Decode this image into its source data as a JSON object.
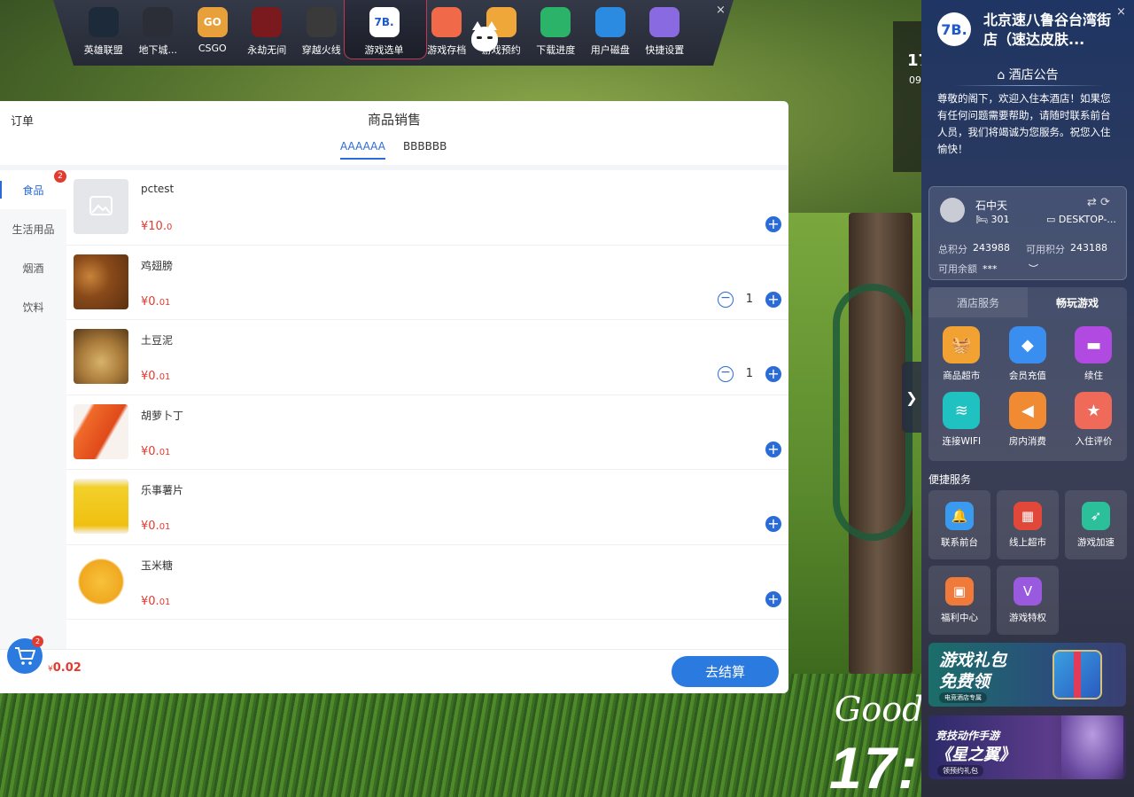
{
  "topbar": {
    "items": [
      {
        "label": "英雄联盟",
        "icon": "lol-icon",
        "color": "#1d2a3a"
      },
      {
        "label": "地下城...",
        "icon": "dnf-icon",
        "color": "#2b2e36"
      },
      {
        "label": "CSGO",
        "icon": "csgo-icon",
        "color": "#e8a13a",
        "text": "GO"
      },
      {
        "label": "永劫无间",
        "icon": "naraka-icon",
        "color": "#7a1a1e"
      },
      {
        "label": "穿越火线",
        "icon": "cf-icon",
        "color": "#3a3a3a"
      },
      {
        "label": "游戏选单",
        "icon": "menu-logo-icon",
        "color": "#ffffff",
        "text": "7B."
      },
      {
        "label": "游戏存档",
        "icon": "save-icon",
        "color": "#f06a4a"
      },
      {
        "label": "游戏预约",
        "icon": "reserve-icon",
        "color": "#f0a73a"
      },
      {
        "label": "下载进度",
        "icon": "download-icon",
        "color": "#2bb36a"
      },
      {
        "label": "用户磁盘",
        "icon": "disk-icon",
        "color": "#2b8be0"
      },
      {
        "label": "快捷设置",
        "icon": "settings-icon",
        "color": "#8a6ae0"
      }
    ],
    "close": "×"
  },
  "panel": {
    "order_label": "订单",
    "title": "商品销售",
    "tabs": [
      "AAAAAA",
      "BBBBBB"
    ],
    "active_tab": 0,
    "categories": [
      "食品",
      "生活用品",
      "烟酒",
      "饮料"
    ],
    "category_badge": "2",
    "products": [
      {
        "name": "pctest",
        "price_main": "¥10.",
        "price_dec": "0",
        "qty": null,
        "thumb": "placeholder-image-icon"
      },
      {
        "name": "鸡翅膀",
        "price_main": "¥0.",
        "price_dec": "01",
        "qty": "1",
        "thumb": "chicken-wings-image"
      },
      {
        "name": "土豆泥",
        "price_main": "¥0.",
        "price_dec": "01",
        "qty": "1",
        "thumb": "mashed-potato-image"
      },
      {
        "name": "胡萝卜丁",
        "price_main": "¥0.",
        "price_dec": "01",
        "qty": null,
        "thumb": "carrot-image"
      },
      {
        "name": "乐事薯片",
        "price_main": "¥0.",
        "price_dec": "01",
        "qty": null,
        "thumb": "chips-image"
      },
      {
        "name": "玉米糖",
        "price_main": "¥0.",
        "price_dec": "01",
        "qty": null,
        "thumb": "corn-candy-image"
      }
    ],
    "cart_badge": "2",
    "total_prefix": "¥",
    "total": "0.02",
    "checkout_label": "去结算",
    "accent": "#2b7ae0",
    "price_color": "#e23b30"
  },
  "hotel": {
    "logo_text": "7B.",
    "name": "北京速八鲁谷台湾街店（速达皮肤...",
    "close": "×",
    "notice_title": "酒店公告",
    "notice_text": "尊敬的阁下，欢迎入住本酒店！如果您有任何问题需要帮助，请随时联系前台人员，我们将竭诚为您服务。祝您入住愉快！",
    "user": {
      "name": "石中天",
      "room": "301",
      "pc": "DESKTOP-...",
      "total_points_label": "总积分",
      "total_points": "243988",
      "avail_points_label": "可用积分",
      "avail_points": "243188",
      "balance_label": "可用余额",
      "balance": "***"
    },
    "service_tabs": [
      "酒店服务",
      "畅玩游戏"
    ],
    "active_service_tab": 1,
    "services": [
      {
        "label": "商品超市",
        "icon": "basket-icon",
        "color": "#f2a233"
      },
      {
        "label": "会员充值",
        "icon": "diamond-icon",
        "color": "#3a8ef0"
      },
      {
        "label": "续住",
        "icon": "bed-icon",
        "color": "#b04ae0"
      },
      {
        "label": "连接WIFI",
        "icon": "wifi-icon",
        "color": "#1fc1c1"
      },
      {
        "label": "房内消费",
        "icon": "triangle-icon",
        "color": "#f08a33"
      },
      {
        "label": "入住评价",
        "icon": "star-icon",
        "color": "#f06a5a"
      }
    ],
    "quick_title": "便捷服务",
    "quick": [
      {
        "label": "联系前台",
        "icon": "bell-icon",
        "color": "#3a9af0"
      },
      {
        "label": "线上超市",
        "icon": "store-icon",
        "color": "#e2483a"
      },
      {
        "label": "游戏加速",
        "icon": "rocket-icon",
        "color": "#2bbf9a"
      },
      {
        "label": "福利中心",
        "icon": "gift-icon",
        "color": "#f07a3a"
      },
      {
        "label": "游戏特权",
        "icon": "vip-icon",
        "color": "#9a5ae0"
      }
    ],
    "banner1": {
      "line1": "游戏礼包",
      "line2": "免费领",
      "sub": "电竞酒店专属"
    },
    "banner2": {
      "line1": "竞技动作手游",
      "line2": "《星之翼》",
      "sub": "领预约礼包"
    }
  },
  "background": {
    "good_text": "Good C",
    "clock": "17:",
    "frame_time": "17",
    "frame_date": "09"
  }
}
